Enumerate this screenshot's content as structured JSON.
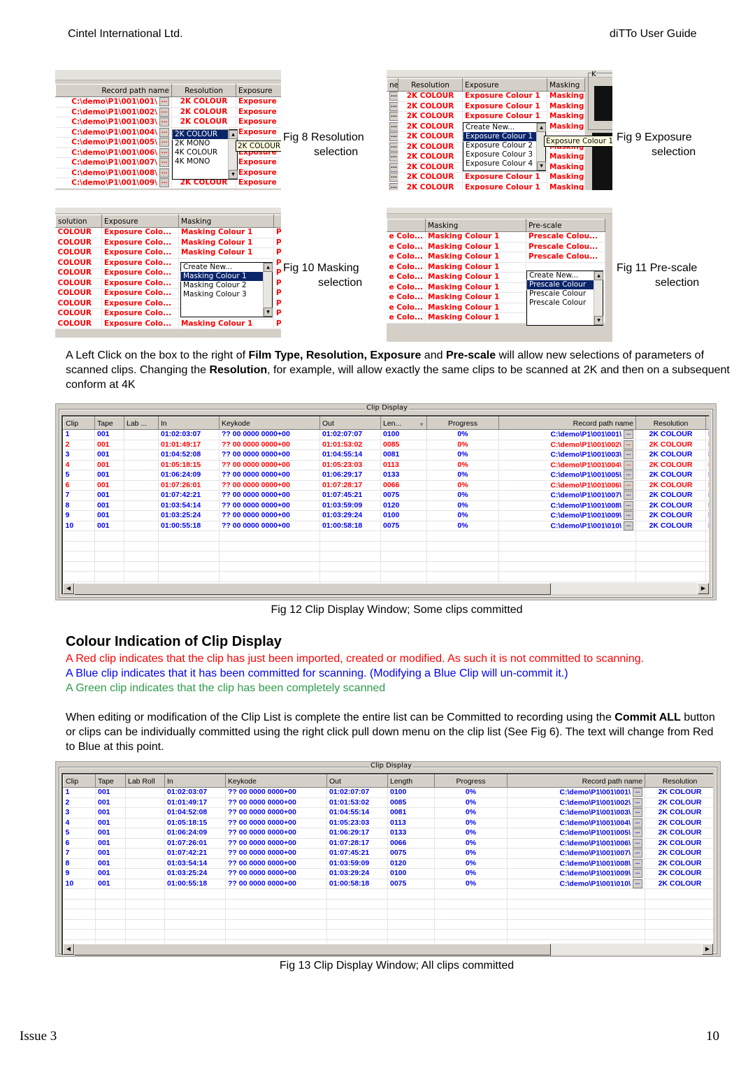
{
  "header": {
    "left": "Cintel International Ltd.",
    "right": "diTTo User Guide"
  },
  "footer": {
    "left": "Issue 3",
    "right": "10"
  },
  "colors": {
    "red": "#ff0000",
    "blue": "#0000ee",
    "green": "#2e9b4a",
    "selection": "#0a246a",
    "tooltip": "#ffffe1"
  },
  "fig8": {
    "caption_line1": "Fig 8 Resolution",
    "caption_line2": "selection",
    "headers": [
      "Record path name",
      "Resolution",
      "Exposure"
    ],
    "rows": [
      {
        "path": "C:\\demo\\P1\\001\\001\\",
        "res": "2K COLOUR",
        "exp": "Exposure"
      },
      {
        "path": "C:\\demo\\P1\\001\\002\\",
        "res": "2K COLOUR",
        "exp": "Exposure"
      },
      {
        "path": "C:\\demo\\P1\\001\\003\\",
        "res": "2K COLOUR",
        "exp": "Exposure"
      },
      {
        "path": "C:\\demo\\P1\\001\\004\\",
        "res": "",
        "exp": "Exposure"
      },
      {
        "path": "C:\\demo\\P1\\001\\005\\",
        "res": "",
        "exp": ""
      },
      {
        "path": "C:\\demo\\P1\\001\\006\\",
        "res": "",
        "exp": "Exposure"
      },
      {
        "path": "C:\\demo\\P1\\001\\007\\",
        "res": "",
        "exp": "Exposure"
      },
      {
        "path": "C:\\demo\\P1\\001\\008\\",
        "res": "",
        "exp": "Exposure"
      },
      {
        "path": "C:\\demo\\P1\\001\\009\\",
        "res": "2K COLOUR",
        "exp": "Exposure"
      }
    ],
    "ellipsis": "...",
    "dropdown": {
      "options": [
        "2K COLOUR",
        "2K MONO",
        "4K COLOUR",
        "4K MONO"
      ],
      "selected": "2K COLOUR"
    },
    "tooltip": "2K COLOUR"
  },
  "fig9": {
    "caption_line1": "Fig 9 Exposure",
    "caption_line2": "selection",
    "headers": [
      "ne",
      "Resolution",
      "Exposure",
      "Masking"
    ],
    "rows": [
      {
        "res": "2K COLOUR",
        "exp": "Exposure Colour 1",
        "mask": "Masking"
      },
      {
        "res": "2K COLOUR",
        "exp": "Exposure Colour 1",
        "mask": "Masking"
      },
      {
        "res": "2K COLOUR",
        "exp": "Exposure Colour 1",
        "mask": "Masking"
      },
      {
        "res": "2K COLOUR",
        "exp": "",
        "mask": "Masking"
      },
      {
        "res": "2K COLOUR",
        "exp": "",
        "mask": ""
      },
      {
        "res": "2K COLOUR",
        "exp": "",
        "mask": "Masking"
      },
      {
        "res": "2K COLOUR",
        "exp": "",
        "mask": "Masking"
      },
      {
        "res": "2K COLOUR",
        "exp": "",
        "mask": "Masking"
      },
      {
        "res": "2K COLOUR",
        "exp": "Exposure Colour 1",
        "mask": "Masking"
      },
      {
        "res": "2K COLOUR",
        "exp": "Exposure Colour 1",
        "mask": "Masking"
      }
    ],
    "ellipsis": "...",
    "dropdown": {
      "options": [
        "Create New...",
        "Exposure Colour 1",
        "Exposure Colour 2",
        "Exposure Colour 3",
        "Exposure Colour 4"
      ],
      "selected": "Exposure Colour 1"
    },
    "tooltip": "Exposure Colour 1",
    "side_label": "K"
  },
  "fig10": {
    "caption_line1": "Fig 10 Masking",
    "caption_line2": "selection",
    "headers": [
      "solution",
      "Exposure",
      "Masking",
      ""
    ],
    "rows": [
      {
        "res": "COLOUR",
        "exp": "Exposure Colo...",
        "mask": "Masking Colour 1",
        "p": "P"
      },
      {
        "res": "COLOUR",
        "exp": "Exposure Colo...",
        "mask": "Masking Colour 1",
        "p": "P"
      },
      {
        "res": "COLOUR",
        "exp": "Exposure Colo...",
        "mask": "Masking Colour 1",
        "p": "P"
      },
      {
        "res": "COLOUR",
        "exp": "Exposure Colo...",
        "mask": "",
        "p": "P"
      },
      {
        "res": "COLOUR",
        "exp": "Exposure Colo...",
        "mask": "",
        "p": "P"
      },
      {
        "res": "COLOUR",
        "exp": "Exposure Colo...",
        "mask": "",
        "p": "P"
      },
      {
        "res": "COLOUR",
        "exp": "Exposure Colo...",
        "mask": "",
        "p": "P"
      },
      {
        "res": "COLOUR",
        "exp": "Exposure Colo...",
        "mask": "",
        "p": "P"
      },
      {
        "res": "COLOUR",
        "exp": "Exposure Colo...",
        "mask": "Masking Colour 1",
        "p": "P"
      },
      {
        "res": "COLOUR",
        "exp": "Exposure Colo...",
        "mask": "Masking Colour 1",
        "p": "P"
      }
    ],
    "dropdown": {
      "options": [
        "Create New...",
        "Masking Colour 1",
        "Masking Colour 2",
        "Masking Colour 3"
      ],
      "selected": "Masking Colour 1"
    }
  },
  "fig11": {
    "caption_line1": "Fig 11 Pre-scale",
    "caption_line2": "selection",
    "headers": [
      "",
      "Masking",
      "Pre-scale"
    ],
    "rows": [
      {
        "exp": "e Colo...",
        "mask": "Masking Colour 1",
        "pre": "Prescale Colou..."
      },
      {
        "exp": "e Colo...",
        "mask": "Masking Colour 1",
        "pre": "Prescale Colou..."
      },
      {
        "exp": "e Colo...",
        "mask": "Masking Colour 1",
        "pre": "Prescale Colou..."
      },
      {
        "exp": "e Colo...",
        "mask": "Masking Colour 1",
        "pre": ""
      },
      {
        "exp": "e Colo...",
        "mask": "Masking Colour 1",
        "pre": ""
      },
      {
        "exp": "e Colo...",
        "mask": "Masking Colour 1",
        "pre": ""
      },
      {
        "exp": "e Colo...",
        "mask": "Masking Colour 1",
        "pre": ""
      },
      {
        "exp": "e Colo...",
        "mask": "Masking Colour 1",
        "pre": ""
      },
      {
        "exp": "e Colo...",
        "mask": "Masking Colour 1",
        "pre": "Prescale Colou..."
      }
    ],
    "dropdown": {
      "options": [
        "Create New...",
        "Prescale Colour",
        "Prescale Colour",
        "Prescale Colour"
      ],
      "selected_index": 1
    }
  },
  "intro_paragraph": {
    "t1": "A Left Click on the box to the right of ",
    "b1": "Film Type, Resolution, Exposure",
    "t2": " and ",
    "b2": "Pre-scale",
    "t3": " will allow new selections of parameters of scanned clips. Changing the ",
    "b3": "Resolution",
    "t4": ", for example, will allow exactly the same clips to be scanned at 2K and then on a subsequent conform at  4K"
  },
  "fig12": {
    "title": "Clip Display",
    "caption": "Fig 12 Clip Display Window; Some clips committed",
    "headers": [
      "Clip",
      "Tape",
      "Lab ...",
      "In",
      "Keykode",
      "Out",
      "Len...",
      "Progress",
      "Record path name",
      "Resolution",
      ""
    ],
    "sort_column": "Len...",
    "rows": [
      {
        "state": "blue",
        "clip": "1",
        "tape": "001",
        "lab": "",
        "in": "01:02:03:07",
        "key": "?? 00 0000 0000+00",
        "out": "01:02:07:07",
        "len": "0100",
        "prog": "0%",
        "path": "C:\\demo\\P1\\001\\001\\",
        "res": "2K COLOUR",
        "e": "E"
      },
      {
        "state": "red",
        "clip": "2",
        "tape": "001",
        "lab": "",
        "in": "01:01:49:17",
        "key": "?? 00 0000 0000+00",
        "out": "01:01:53:02",
        "len": "0085",
        "prog": "0%",
        "path": "C:\\demo\\P1\\001\\002\\",
        "res": "2K COLOUR",
        "e": "E"
      },
      {
        "state": "blue",
        "clip": "3",
        "tape": "001",
        "lab": "",
        "in": "01:04:52:08",
        "key": "?? 00 0000 0000+00",
        "out": "01:04:55:14",
        "len": "0081",
        "prog": "0%",
        "path": "C:\\demo\\P1\\001\\003\\",
        "res": "2K COLOUR",
        "e": "E"
      },
      {
        "state": "red",
        "clip": "4",
        "tape": "001",
        "lab": "",
        "in": "01:05:18:15",
        "key": "?? 00 0000 0000+00",
        "out": "01:05:23:03",
        "len": "0113",
        "prog": "0%",
        "path": "C:\\demo\\P1\\001\\004\\",
        "res": "2K COLOUR",
        "e": "E"
      },
      {
        "state": "blue",
        "clip": "5",
        "tape": "001",
        "lab": "",
        "in": "01:06:24:09",
        "key": "?? 00 0000 0000+00",
        "out": "01:06:29:17",
        "len": "0133",
        "prog": "0%",
        "path": "C:\\demo\\P1\\001\\005\\",
        "res": "2K COLOUR",
        "e": "E"
      },
      {
        "state": "red",
        "clip": "6",
        "tape": "001",
        "lab": "",
        "in": "01:07:26:01",
        "key": "?? 00 0000 0000+00",
        "out": "01:07:28:17",
        "len": "0066",
        "prog": "0%",
        "path": "C:\\demo\\P1\\001\\006\\",
        "res": "2K COLOUR",
        "e": "E"
      },
      {
        "state": "blue",
        "clip": "7",
        "tape": "001",
        "lab": "",
        "in": "01:07:42:21",
        "key": "?? 00 0000 0000+00",
        "out": "01:07:45:21",
        "len": "0075",
        "prog": "0%",
        "path": "C:\\demo\\P1\\001\\007\\",
        "res": "2K COLOUR",
        "e": "E"
      },
      {
        "state": "blue",
        "clip": "8",
        "tape": "001",
        "lab": "",
        "in": "01:03:54:14",
        "key": "?? 00 0000 0000+00",
        "out": "01:03:59:09",
        "len": "0120",
        "prog": "0%",
        "path": "C:\\demo\\P1\\001\\008\\",
        "res": "2K COLOUR",
        "e": "E"
      },
      {
        "state": "blue",
        "clip": "9",
        "tape": "001",
        "lab": "",
        "in": "01:03:25:24",
        "key": "?? 00 0000 0000+00",
        "out": "01:03:29:24",
        "len": "0100",
        "prog": "0%",
        "path": "C:\\demo\\P1\\001\\009\\",
        "res": "2K COLOUR",
        "e": "E"
      },
      {
        "state": "blue",
        "clip": "10",
        "tape": "001",
        "lab": "",
        "in": "01:00:55:18",
        "key": "?? 00 0000 0000+00",
        "out": "01:00:58:18",
        "len": "0075",
        "prog": "0%",
        "path": "C:\\demo\\P1\\001\\010\\",
        "res": "2K COLOUR",
        "e": "E"
      }
    ]
  },
  "colour_section": {
    "heading": "Colour Indication of Clip Display",
    "red_line": "A Red clip indicates that the clip has just been imported, created or modified. As such it is not committed to scanning.",
    "blue_line": "A Blue clip indicates that it has been committed for scanning. (Modifying a Blue Clip will un-commit it.)",
    "green_line": "A Green clip indicates that the clip has been completely scanned",
    "p_t1": "When editing or modification of the Clip List is complete the entire list can be Committed to recording using the ",
    "p_b1": "Commit ALL",
    "p_t2": " button or  clips can be individually committed using the right click pull down menu on the clip list (See Fig 6).  The text will change from Red to Blue at this point."
  },
  "fig13": {
    "title": "Clip Display",
    "caption": "Fig 13 Clip Display Window; All clips committed",
    "headers": [
      "Clip",
      "Tape",
      "Lab Roll",
      "In",
      "Keykode",
      "Out",
      "Length",
      "Progress",
      "Record path name",
      "Resolution",
      ""
    ],
    "rows": [
      {
        "clip": "1",
        "tape": "001",
        "lab": "",
        "in": "01:02:03:07",
        "key": "?? 00 0000 0000+00",
        "out": "01:02:07:07",
        "len": "0100",
        "prog": "0%",
        "path": "C:\\demo\\P1\\001\\001\\",
        "res": "2K COLOUR"
      },
      {
        "clip": "2",
        "tape": "001",
        "lab": "",
        "in": "01:01:49:17",
        "key": "?? 00 0000 0000+00",
        "out": "01:01:53:02",
        "len": "0085",
        "prog": "0%",
        "path": "C:\\demo\\P1\\001\\002\\",
        "res": "2K COLOUR"
      },
      {
        "clip": "3",
        "tape": "001",
        "lab": "",
        "in": "01:04:52:08",
        "key": "?? 00 0000 0000+00",
        "out": "01:04:55:14",
        "len": "0081",
        "prog": "0%",
        "path": "C:\\demo\\P1\\001\\003\\",
        "res": "2K COLOUR"
      },
      {
        "clip": "4",
        "tape": "001",
        "lab": "",
        "in": "01:05:18:15",
        "key": "?? 00 0000 0000+00",
        "out": "01:05:23:03",
        "len": "0113",
        "prog": "0%",
        "path": "C:\\demo\\P1\\001\\004\\",
        "res": "2K COLOUR"
      },
      {
        "clip": "5",
        "tape": "001",
        "lab": "",
        "in": "01:06:24:09",
        "key": "?? 00 0000 0000+00",
        "out": "01:06:29:17",
        "len": "0133",
        "prog": "0%",
        "path": "C:\\demo\\P1\\001\\005\\",
        "res": "2K COLOUR"
      },
      {
        "clip": "6",
        "tape": "001",
        "lab": "",
        "in": "01:07:26:01",
        "key": "?? 00 0000 0000+00",
        "out": "01:07:28:17",
        "len": "0066",
        "prog": "0%",
        "path": "C:\\demo\\P1\\001\\006\\",
        "res": "2K COLOUR"
      },
      {
        "clip": "7",
        "tape": "001",
        "lab": "",
        "in": "01:07:42:21",
        "key": "?? 00 0000 0000+00",
        "out": "01:07:45:21",
        "len": "0075",
        "prog": "0%",
        "path": "C:\\demo\\P1\\001\\007\\",
        "res": "2K COLOUR"
      },
      {
        "clip": "8",
        "tape": "001",
        "lab": "",
        "in": "01:03:54:14",
        "key": "?? 00 0000 0000+00",
        "out": "01:03:59:09",
        "len": "0120",
        "prog": "0%",
        "path": "C:\\demo\\P1\\001\\008\\",
        "res": "2K COLOUR"
      },
      {
        "clip": "9",
        "tape": "001",
        "lab": "",
        "in": "01:03:25:24",
        "key": "?? 00 0000 0000+00",
        "out": "01:03:29:24",
        "len": "0100",
        "prog": "0%",
        "path": "C:\\demo\\P1\\001\\009\\",
        "res": "2K COLOUR"
      },
      {
        "clip": "10",
        "tape": "001",
        "lab": "",
        "in": "01:00:55:18",
        "key": "?? 00 0000 0000+00",
        "out": "01:00:58:18",
        "len": "0075",
        "prog": "0%",
        "path": "C:\\demo\\P1\\001\\010\\",
        "res": "2K COLOUR"
      }
    ]
  }
}
